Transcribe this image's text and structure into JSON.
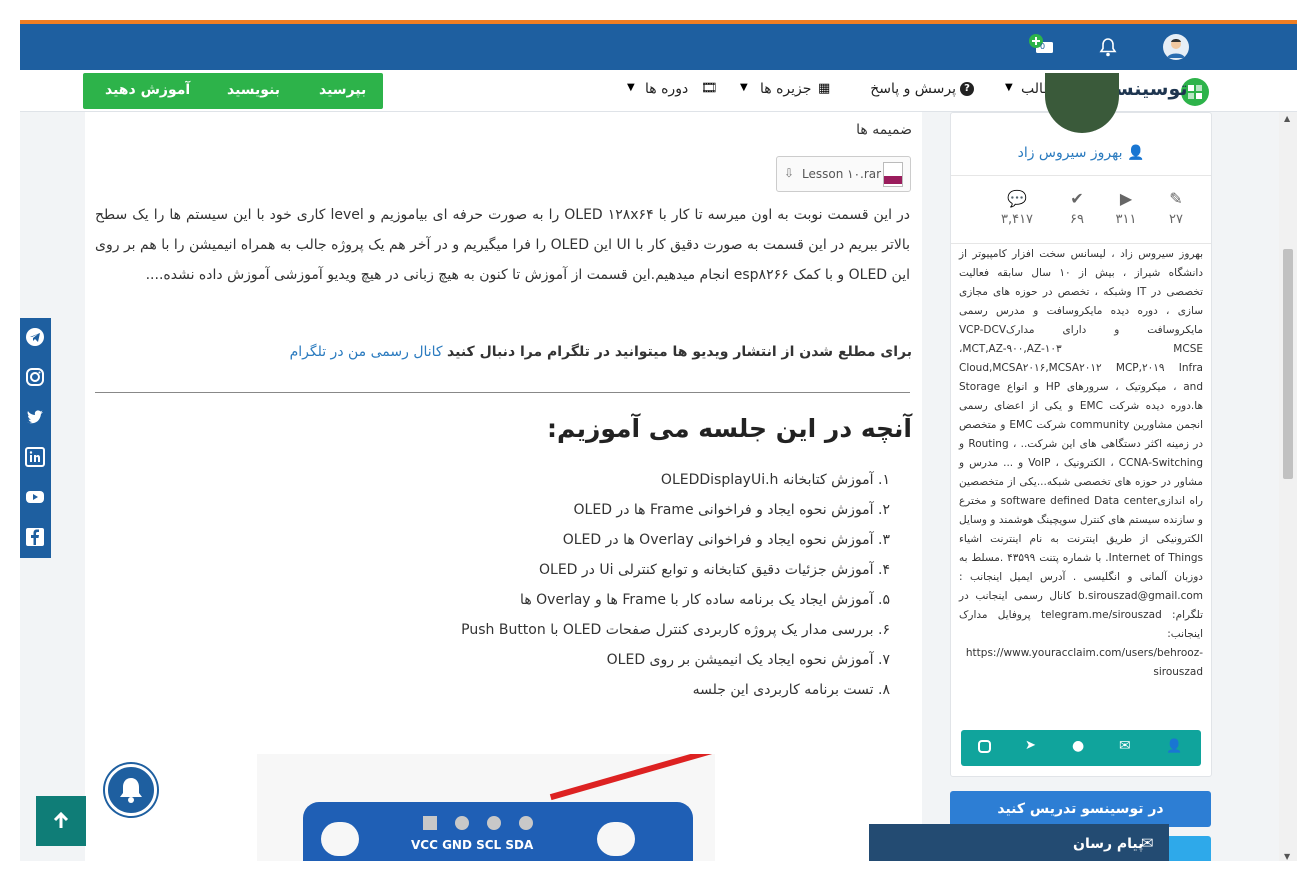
{
  "topbar": {
    "notification_badge": "0"
  },
  "brand": {
    "name": "توسینسو"
  },
  "nav": {
    "items": [
      "مطالب",
      "پرسش و پاسخ",
      "جزیره ها",
      "دوره ها"
    ],
    "actions": [
      "بپرسید",
      "بنویسید",
      "آموزش دهید"
    ]
  },
  "content": {
    "attachments_title": "ضمیمه ها",
    "attachment_file": "Lesson ۱۰.rar",
    "intro": "در این قسمت نوبت به اون میرسه تا کار با OLED ۱۲۸x۶۴ را به صورت حرفه ای بیاموزیم و level کاری خود با این سیستم ها را یک سطح بالاتر ببریم در این قسمت به صورت دقیق کار با UI این OLED را فرا میگیریم و در آخر هم یک پروژه جالب به همراه انیمیشن را با هم بر روی این OLED و با کمک esp۸۲۶۶ انجام میدهیم.این قسمت از آموزش تا کنون به هیچ زبانی در هیچ ویدیو آموزشی آموزش داده نشده....",
    "telegram_text": "برای مطلع شدن از انتشار ویدیو ها میتوانید در تلگرام مرا دنبال کنید",
    "telegram_link": "کانال رسمی من در تلگرام",
    "section_title": "آنچه در این جلسه می آموزیم:",
    "list": [
      "۱. آموزش کتابخانه OLEDDisplayUi.h",
      "۲. آموزش نحوه ایجاد و فراخوانی Frame ها در OLED",
      "۳. آموزش نحوه ایجاد و فراخوانی Overlay ها در OLED",
      "۴. آموزش جزئیات دقیق کتابخانه و توابع کنترلی Ui در OLED",
      "۵. آموزش ایجاد یک برنامه ساده کار با Frame ها و Overlay ها",
      "۶. بررسی مدار یک پروژه کاربردی کنترل صفحات OLED با Push Button",
      "۷. آموزش نحوه ایجاد یک انیمیشن بر روی OLED",
      "۸. تست برنامه کاربردی این جلسه"
    ],
    "board_pins": "VCC GND SCL SDA"
  },
  "author": {
    "name": "بهروز سیروس زاد",
    "stats": [
      {
        "icon": "pencil-icon",
        "value": "۲۷"
      },
      {
        "icon": "play-icon",
        "value": "۳۱۱"
      },
      {
        "icon": "check-icon",
        "value": "۶۹"
      },
      {
        "icon": "comment-icon",
        "value": "۳,۴۱۷"
      }
    ],
    "bio": "بهروز سیروس زاد ، لیسانس سخت افزار کامپیوتر از دانشگاه شیراز ، بیش از ۱۰ سال سابقه فعالیت تخصصی در IT وشبکه ، تخصص در حوزه های مجازی سازی ، دوره دیده مایکروسافت و مدرس رسمی مایکروسافت و دارای مدارکVCP-DCV ،MCT,AZ-۹۰۰,AZ-۱۰۳ MCSE Cloud,MCSA۲۰۱۶,MCSA۲۰۱۲ MCP,۲۰۱۹ Infra and ، میکروتیک ، سرورهای HP و انواع Storage ها.دوره دیده شرکت EMC و یکی از اعضای رسمی انجمن مشاورین community شرکت EMC و متخصص در زمینه اکثر دستگاهی های این شرکت.. ، Routing و CCNA-Switching ، الکترونیک ، VoIP و ... مدرس و مشاور در حوزه های تخصصی شبکه...یکی از متخصصین راه اندازیsoftware defined Data center و مخترع و سازنده سیستم های کنترل سویچینگ هوشمند و وسایل الکترونیکی از طریق اینترنت به نام اینترنت اشیاء Internet of Things. با شماره پتنت ۴۳۵۹۹ .مسلط به دوزبان آلمانی و انگلیسی . آدرس ایمیل اینجانب : b.sirouszad@gmail.com کانال رسمی اینجانب در تلگرام: telegram.me/sirouszad پروفایل مدارک اینجانب: https://www.youracclaim.com/users/behrooz-sirouszad"
  },
  "sidebar": {
    "teach_button": "در توسینسو تدریس کنید",
    "messenger_label": "پیام رسان"
  },
  "colors": {
    "accent": "#1e5fa0",
    "green": "#2db34a",
    "teal": "#10a49c",
    "orange": "#f07e22"
  }
}
